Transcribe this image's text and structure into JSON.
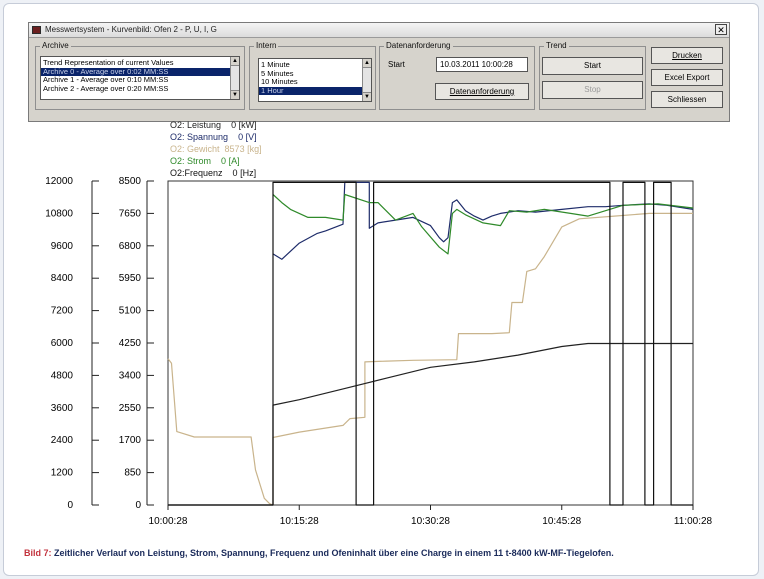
{
  "window": {
    "title": "Messwertsystem - Kurvenbild: Ofen 2 - P, U, I, G"
  },
  "archive": {
    "label": "Archive",
    "items": [
      {
        "label": "Trend Representation of current Values",
        "selected": false
      },
      {
        "label": "Archive 0 - Average over 0:02 MM:SS",
        "selected": true
      },
      {
        "label": "Archive 1 - Average over 0:10 MM:SS",
        "selected": false
      },
      {
        "label": "Archive 2 - Average over 0:20 MM:SS",
        "selected": false
      }
    ]
  },
  "interval": {
    "label": "Intern",
    "items": [
      {
        "label": "1 Minute",
        "selected": false
      },
      {
        "label": "5 Minutes",
        "selected": false
      },
      {
        "label": "10 Minutes",
        "selected": false
      },
      {
        "label": "1 Hour",
        "selected": true
      }
    ]
  },
  "data_request": {
    "label": "Datenanforderung",
    "start_label": "Start",
    "start_value": "10.03.2011 10:00:28",
    "button": "Datenanforderung"
  },
  "trend": {
    "label": "Trend",
    "start": "Start",
    "stop": "Stop"
  },
  "actions": {
    "print": "Drucken",
    "excel": "Excel Export",
    "close": "Schliessen"
  },
  "signals": [
    {
      "name": "O2: Leistung",
      "value": "0",
      "unit": "[kW]",
      "color": "#222222"
    },
    {
      "name": "O2: Spannung",
      "value": "0",
      "unit": "[V]",
      "color": "#1e2c6a"
    },
    {
      "name": "O2: Gewicht",
      "value": "8573",
      "unit": "[kg]",
      "color": "#c9b48c"
    },
    {
      "name": "O2: Strom",
      "value": "0",
      "unit": "[A]",
      "color": "#2f8a2a"
    },
    {
      "name": "O2:Frequenz",
      "value": "0",
      "unit": "[Hz]",
      "color": "#111111"
    }
  ],
  "chart_data": {
    "type": "line",
    "x_ticks": [
      "10:00:28",
      "10:15:28",
      "10:30:28",
      "10:45:28",
      "11:00:28"
    ],
    "xlim_minutes": [
      0,
      60
    ],
    "y1_ticks": [
      "12000",
      "10800",
      "9600",
      "8400",
      "7200",
      "6000",
      "4800",
      "3600",
      "2400",
      "1200",
      "0"
    ],
    "y1lim": [
      0,
      12000
    ],
    "y2_ticks": [
      "8500",
      "7650",
      "6800",
      "5950",
      "5100",
      "4250",
      "3400",
      "2550",
      "1700",
      "850",
      "0"
    ],
    "y2lim": [
      0,
      8500
    ],
    "series": [
      {
        "name": "O2: Gewicht",
        "color": "#c9b48c",
        "points": [
          [
            0,
            5420
          ],
          [
            0.4,
            5250
          ],
          [
            1,
            2720
          ],
          [
            3,
            2520
          ],
          [
            9.5,
            2520
          ],
          [
            10,
            1300
          ],
          [
            11,
            250
          ],
          [
            11.6,
            50
          ],
          [
            12,
            0
          ],
          [
            12,
            2500
          ],
          [
            15,
            2700
          ],
          [
            20,
            2950
          ],
          [
            20.8,
            3200
          ],
          [
            22.5,
            3250
          ],
          [
            22.5,
            5300
          ],
          [
            25,
            5330
          ],
          [
            28,
            5360
          ],
          [
            33,
            5380
          ],
          [
            33.2,
            6350
          ],
          [
            37,
            6350
          ],
          [
            39,
            6380
          ],
          [
            39.3,
            7500
          ],
          [
            40.5,
            7500
          ],
          [
            41,
            8650
          ],
          [
            42,
            8750
          ],
          [
            43,
            9200
          ],
          [
            45,
            10300
          ],
          [
            47,
            10600
          ],
          [
            51,
            10700
          ],
          [
            55,
            10800
          ],
          [
            60,
            10800
          ]
        ]
      },
      {
        "name": "O2: Leistung",
        "color": "#222222",
        "points": [
          [
            0,
            0
          ],
          [
            12,
            0
          ],
          [
            12,
            3700
          ],
          [
            15,
            3900
          ],
          [
            20,
            4300
          ],
          [
            25,
            4700
          ],
          [
            30,
            5100
          ],
          [
            35,
            5300
          ],
          [
            40,
            5550
          ],
          [
            45,
            5870
          ],
          [
            48,
            5980
          ],
          [
            50,
            5980
          ],
          [
            55,
            5980
          ],
          [
            60,
            5980
          ]
        ]
      },
      {
        "name": "O2: Spannung",
        "color": "#1e2c6a",
        "points": [
          [
            12,
            9300
          ],
          [
            13,
            9100
          ],
          [
            15,
            9700
          ],
          [
            17,
            10050
          ],
          [
            18,
            10150
          ],
          [
            20,
            10400
          ],
          [
            20.2,
            11950
          ],
          [
            23,
            11950
          ],
          [
            23,
            10250
          ],
          [
            24,
            10450
          ],
          [
            26,
            10550
          ],
          [
            28,
            10650
          ],
          [
            30,
            10350
          ],
          [
            31,
            9900
          ],
          [
            31.5,
            9750
          ],
          [
            32,
            9900
          ],
          [
            32.5,
            11200
          ],
          [
            33,
            11300
          ],
          [
            34,
            10900
          ],
          [
            35,
            10700
          ],
          [
            36,
            10550
          ],
          [
            37,
            10700
          ],
          [
            38,
            10800
          ],
          [
            40,
            10900
          ],
          [
            42,
            10850
          ],
          [
            45,
            10950
          ],
          [
            48,
            11050
          ],
          [
            50,
            11050
          ],
          [
            52,
            11100
          ],
          [
            55,
            11150
          ],
          [
            57,
            11100
          ],
          [
            60,
            10950
          ]
        ]
      },
      {
        "name": "O2: Strom",
        "color": "#2f8a2a",
        "points": [
          [
            12,
            11500
          ],
          [
            13,
            11200
          ],
          [
            14,
            10950
          ],
          [
            16,
            10650
          ],
          [
            18,
            10650
          ],
          [
            20,
            10550
          ],
          [
            20.2,
            11500
          ],
          [
            23,
            11200
          ],
          [
            24,
            11200
          ],
          [
            26,
            10550
          ],
          [
            28,
            10800
          ],
          [
            29,
            10300
          ],
          [
            31,
            9550
          ],
          [
            32,
            9300
          ],
          [
            32.5,
            10800
          ],
          [
            33,
            10950
          ],
          [
            34,
            10750
          ],
          [
            36,
            10450
          ],
          [
            38,
            10350
          ],
          [
            39,
            10900
          ],
          [
            41,
            10850
          ],
          [
            43,
            10950
          ],
          [
            46,
            10800
          ],
          [
            48,
            10700
          ],
          [
            52,
            11100
          ],
          [
            56,
            11150
          ],
          [
            60,
            11000
          ]
        ]
      },
      {
        "name": "O2:Frequenz",
        "color": "#111111",
        "points": [
          [
            0,
            0
          ],
          [
            12,
            0
          ],
          [
            12,
            11950
          ],
          [
            21.5,
            11950
          ],
          [
            21.5,
            0
          ],
          [
            23.5,
            0
          ],
          [
            23.5,
            11950
          ],
          [
            50.5,
            11950
          ],
          [
            50.5,
            0
          ],
          [
            52,
            0
          ],
          [
            52,
            11950
          ],
          [
            54.5,
            11950
          ],
          [
            54.5,
            0
          ],
          [
            55.5,
            0
          ],
          [
            55.5,
            11950
          ],
          [
            57.5,
            11950
          ],
          [
            57.5,
            0
          ],
          [
            60,
            0
          ]
        ]
      }
    ]
  },
  "caption": {
    "figure": "Bild 7:",
    "text": " Zeitlicher Verlauf von Leistung, Strom, Spannung, Frequenz und Ofeninhalt über eine Charge in einem 11 t-8400 kW-MF-Tiegelofen."
  }
}
